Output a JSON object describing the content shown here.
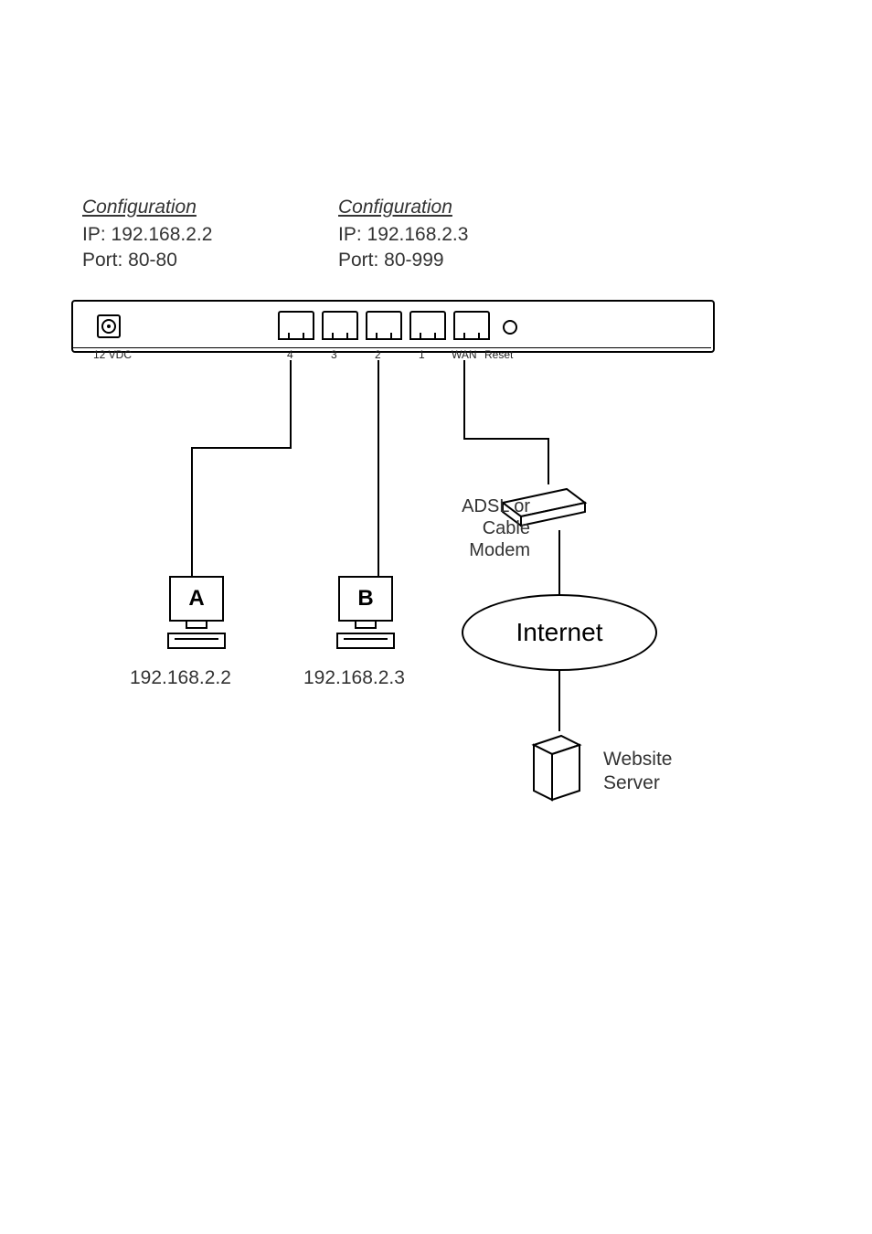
{
  "config_a": {
    "title": "Configuration",
    "ip_label": "IP: 192.168.2.2",
    "port_label": "Port: 80-80"
  },
  "config_b": {
    "title": "Configuration",
    "ip_label": "IP: 192.168.2.3",
    "port_label": "Port: 80-999"
  },
  "router": {
    "power_label": "12 VDC",
    "port4": "4",
    "port3": "3",
    "port2": "2",
    "port1": "1",
    "wan_label": "WAN",
    "reset_label": "Reset"
  },
  "computers": {
    "a": {
      "letter": "A",
      "ip": "192.168.2.2"
    },
    "b": {
      "letter": "B",
      "ip": "192.168.2.3"
    }
  },
  "modem": {
    "label_line1": "ADSL or",
    "label_line2": "Cable Modem"
  },
  "internet": {
    "label": "Internet"
  },
  "server": {
    "label_line1": "Website",
    "label_line2": "Server"
  }
}
